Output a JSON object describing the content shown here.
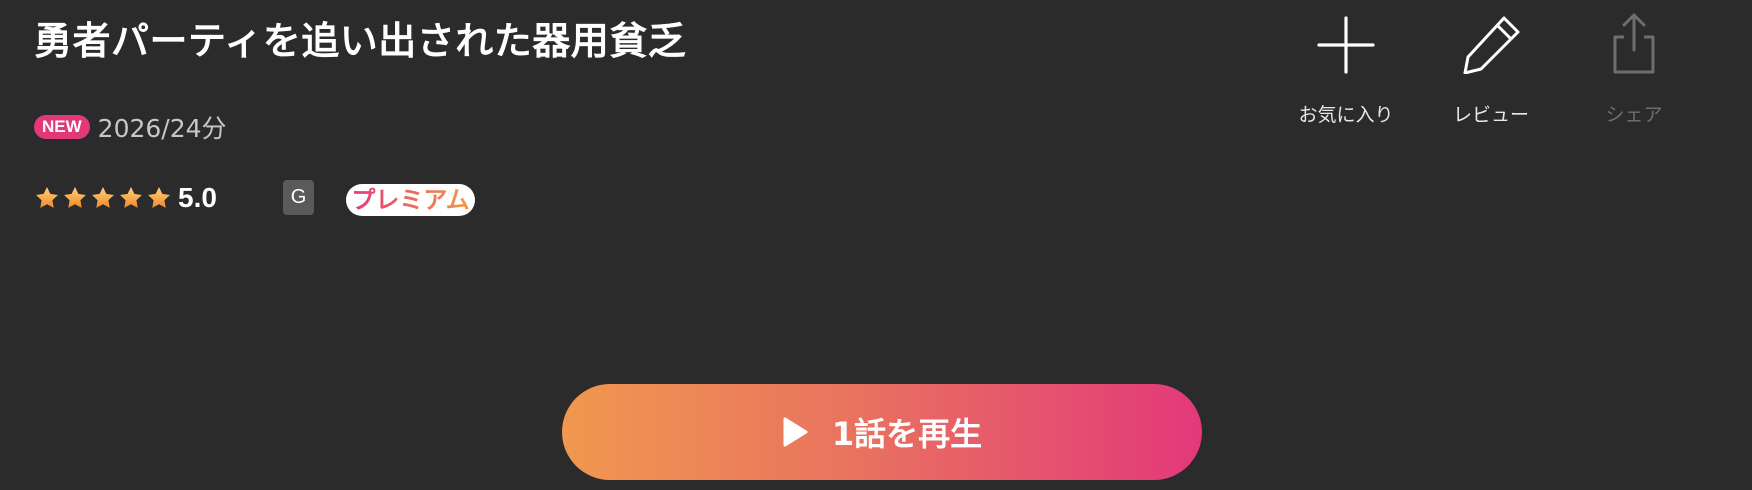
{
  "title": "勇者パーティを追い出された器用貧乏",
  "meta": {
    "new_badge": "NEW",
    "info": "2026/24分"
  },
  "rating": {
    "stars": 5,
    "value": "5.0",
    "star_color": "#f5a623"
  },
  "age_rating": "G",
  "premium_label": "プレミアム",
  "actions": {
    "favorite": {
      "label": "お気に入り",
      "icon": "plus-icon"
    },
    "review": {
      "label": "レビュー",
      "icon": "pencil-icon"
    },
    "share": {
      "label": "シェア",
      "icon": "share-icon",
      "disabled": true
    }
  },
  "play_button": {
    "label": "1話を再生",
    "icon": "play-icon",
    "gradient": [
      "#f0984f",
      "#e3387a"
    ]
  },
  "colors": {
    "background": "#2b2b2b",
    "accent_pink": "#e23878",
    "accent_orange": "#f0984f"
  }
}
